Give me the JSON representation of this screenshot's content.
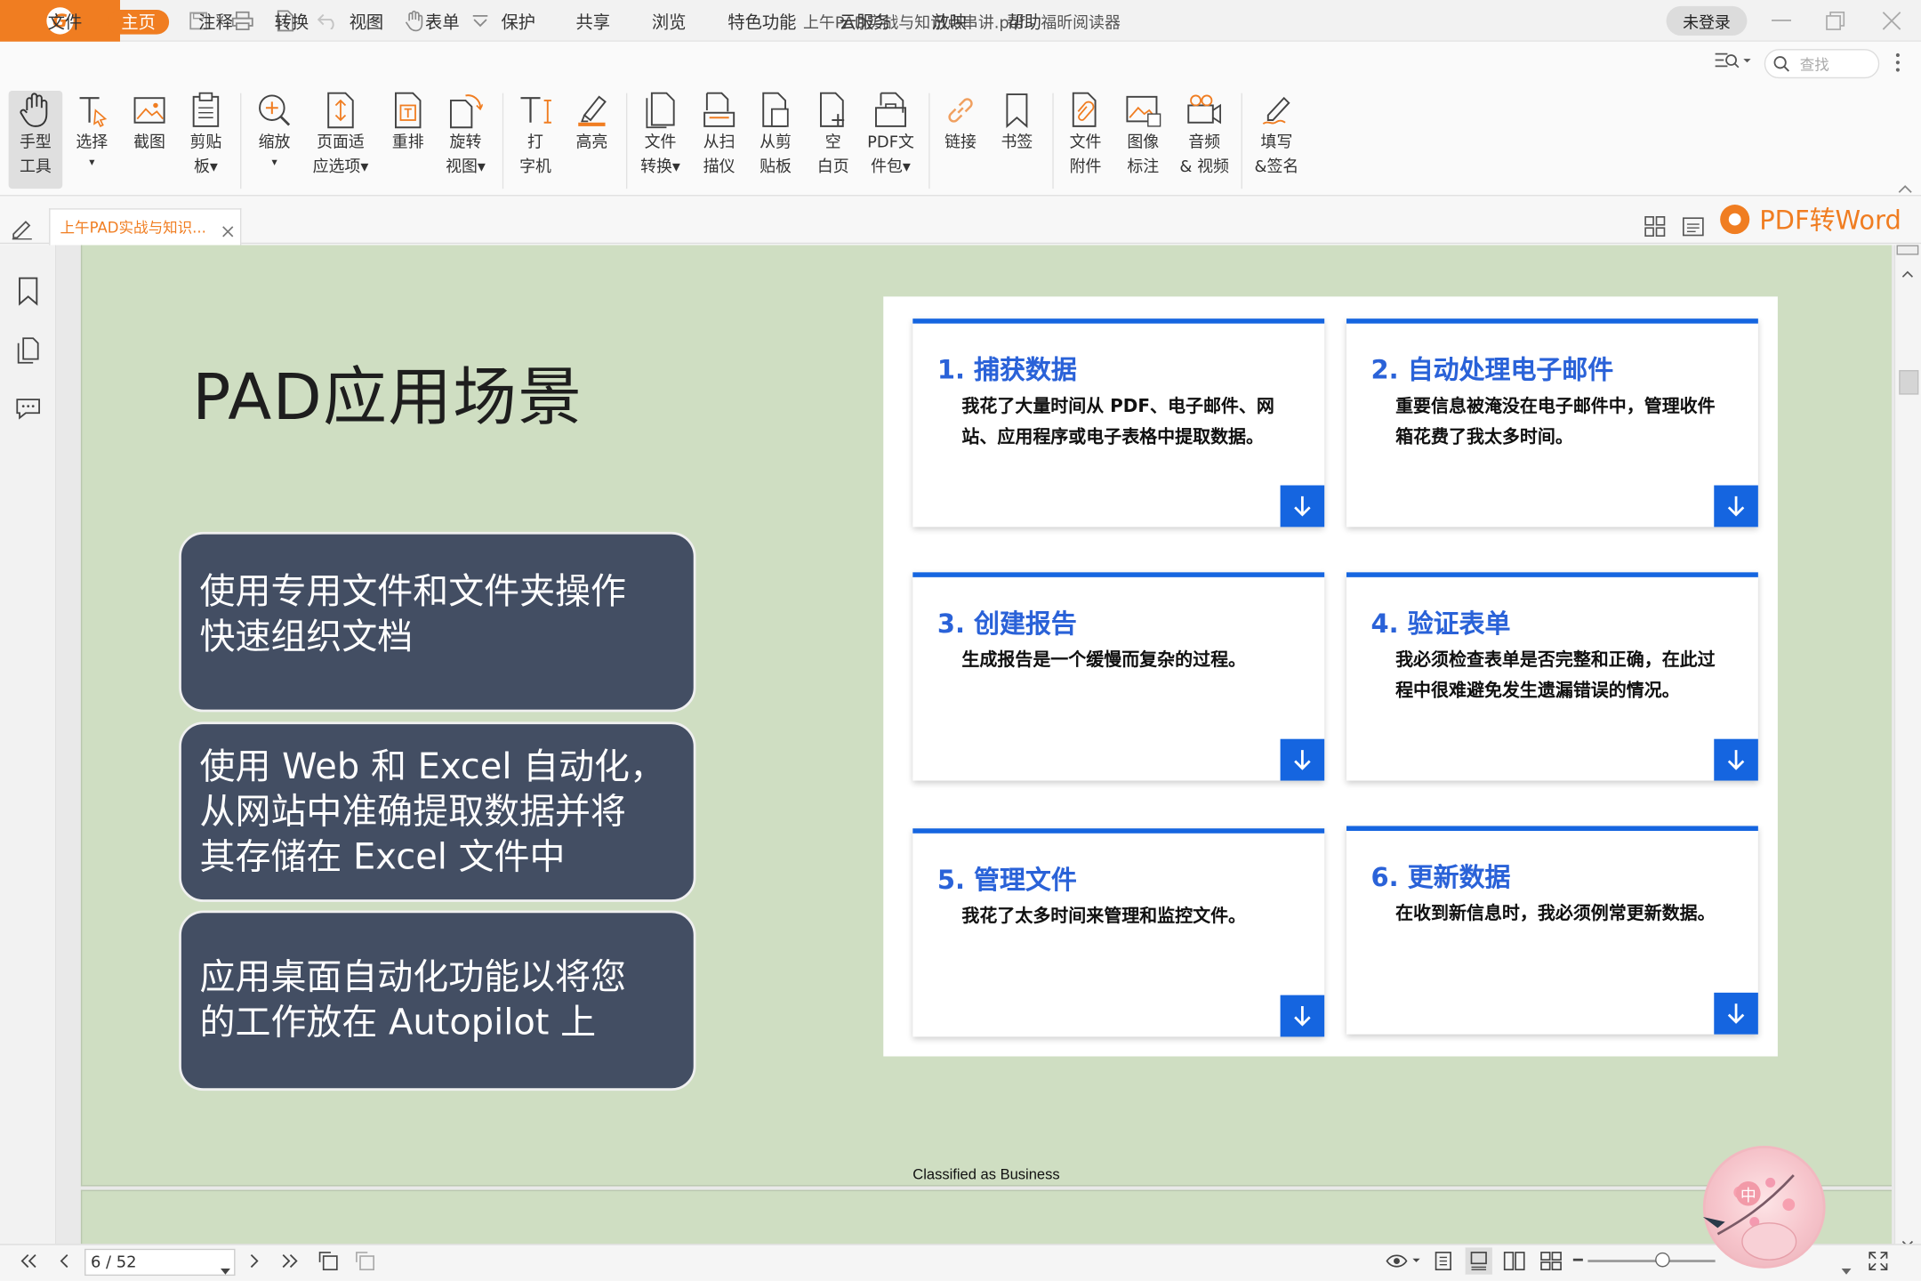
{
  "window": {
    "title": "上午PAD实战与知识点串讲.pdf - 福昕阅读器",
    "login": "未登录"
  },
  "menu": {
    "items": [
      "文件",
      "主页",
      "注释",
      "转换",
      "视图",
      "表单",
      "保护",
      "共享",
      "浏览",
      "特色功能",
      "云服务",
      "放映",
      "帮助"
    ],
    "active": "主页",
    "search_placeholder": "查找"
  },
  "ribbon": {
    "tools": [
      {
        "l1": "手型",
        "l2": "工具"
      },
      {
        "l1": "选择",
        "l2": "▾"
      },
      {
        "l1": "截图",
        "l2": ""
      },
      {
        "l1": "剪贴",
        "l2": "板▾"
      },
      {
        "l1": "缩放",
        "l2": "▾"
      },
      {
        "l1": "页面适",
        "l2": "应选项▾"
      },
      {
        "l1": "重排",
        "l2": ""
      },
      {
        "l1": "旋转",
        "l2": "视图▾"
      },
      {
        "l1": "打",
        "l2": "字机"
      },
      {
        "l1": "高亮",
        "l2": ""
      },
      {
        "l1": "文件",
        "l2": "转换▾"
      },
      {
        "l1": "从扫",
        "l2": "描仪"
      },
      {
        "l1": "从剪",
        "l2": "贴板"
      },
      {
        "l1": "空",
        "l2": "白页"
      },
      {
        "l1": "PDF文",
        "l2": "件包▾"
      },
      {
        "l1": "链接",
        "l2": ""
      },
      {
        "l1": "书签",
        "l2": ""
      },
      {
        "l1": "文件",
        "l2": "附件"
      },
      {
        "l1": "图像",
        "l2": "标注"
      },
      {
        "l1": "音频",
        "l2": "& 视频"
      },
      {
        "l1": "填写",
        "l2": "&签名"
      }
    ]
  },
  "tab": {
    "label": "上午PAD实战与知识..."
  },
  "promo": {
    "label": "PDF转Word"
  },
  "slide": {
    "title": "PAD应用场景",
    "bubbles": [
      "使用专用文件和文件夹操作\n快速组织文档",
      "使用 Web 和 Excel 自动化，\n从网站中准确提取数据并将\n其存储在 Excel 文件中",
      "应用桌面自动化功能以将您\n的工作放在 Autopilot 上"
    ],
    "cards": [
      {
        "title": "1. 捕获数据",
        "body": "我花了大量时间从 PDF、电子邮件、网站、应用程序或电子表格中提取数据。"
      },
      {
        "title": "2. 自动处理电子邮件",
        "body": "重要信息被淹没在电子邮件中，管理收件箱花费了我太多时间。"
      },
      {
        "title": "3. 创建报告",
        "body": "生成报告是一个缓慢而复杂的过程。"
      },
      {
        "title": "4. 验证表单",
        "body": "我必须检查表单是否完整和正确，在此过程中很难避免发生遗漏错误的情况。"
      },
      {
        "title": "5. 管理文件",
        "body": "我花了太多时间来管理和监控文件。"
      },
      {
        "title": "6. 更新数据",
        "body": "在收到新信息时，我必须例常更新数据。"
      }
    ],
    "footer": "Classified as Business"
  },
  "status": {
    "page": "6 / 52"
  },
  "mascot": {
    "label": "中"
  }
}
